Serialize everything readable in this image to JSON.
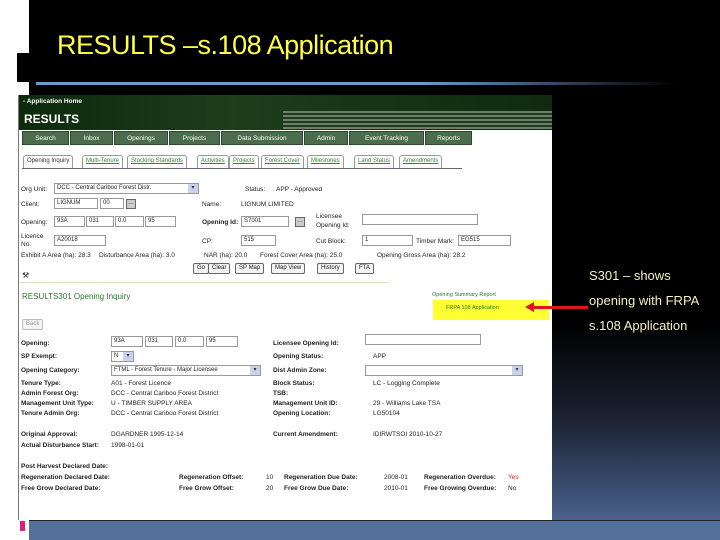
{
  "slide": {
    "title": "RESULTS –s.108 Application",
    "note_lines": [
      "S301 – shows",
      "opening with FRPA",
      "s.108 Application"
    ]
  },
  "app": {
    "home_link": "- Application Home",
    "brand": "RESULTS",
    "nav": [
      "Search",
      "Inbox",
      "Openings",
      "Projects",
      "Data Submission",
      "Admin",
      "Event Tracking",
      "Reports"
    ],
    "tabs": [
      "Opening Inquiry",
      "Multi-Tenure",
      "Stocking Standards",
      "Activities",
      "Projects",
      "Forest Cover",
      "Milestones",
      "Land Status",
      "Amendments"
    ]
  },
  "search": {
    "org_unit_label": "Org Unit:",
    "org_unit_value": "DCC - Central Cariboo Forest Distr.",
    "status_label": "Status:",
    "status_value": "APP - Approved",
    "client_label": "Client:",
    "client_value": "LIGNUM",
    "client_loc": "00",
    "name_label": "Name:",
    "name_value": "LIGNUM LIMITED",
    "opening_label": "Opening:",
    "opening_parts": [
      "93A",
      "031",
      "0.0",
      "95"
    ],
    "opening_id_label": "Opening Id:",
    "opening_id_value": "S7001",
    "licensee_label_1": "Licensee",
    "licensee_label_2": "Opening Id:",
    "licence_label_1": "Licence",
    "licence_label_2": "No:",
    "licence_value": "A20018",
    "cp_label": "CP:",
    "cp_value": "515",
    "cutblock_label": "Cut Block:",
    "cutblock_value": "1",
    "timber_label": "Timber Mark:",
    "timber_value": "EG515",
    "exhibit": "Exhibit A Area (ha): 28.3",
    "disturbance": "Disturbance Area (ha): 3.0",
    "nar": "NAR (ha): 20.0",
    "forest_cover": "Forest Cover Area (ha): 25.0",
    "gross": "Opening Gross Area (ha): 28.2",
    "buttons": [
      "Go",
      "Clear",
      "SP Map",
      "Map View",
      "History",
      "FTA"
    ]
  },
  "result": {
    "title": "RESULTS301   Opening Inquiry",
    "summary_link": "Opening Summary Report",
    "frpa_link": "FRPA 108 Application",
    "back": "Back",
    "opening_label": "Opening:",
    "opening_parts": [
      "93A",
      "031",
      "0.0",
      "95"
    ],
    "licensee_label": "Licensee Opening Id:",
    "sp_label": "SP Exempt:",
    "sp_value": "N",
    "status_label": "Opening Status:",
    "status_value": "APP",
    "category_label": "Opening Category:",
    "category_value": "FTML - Forest Tenure - Major Licensee",
    "zone_label": "Dist Admin Zone:",
    "tenure_type_label": "Tenure Type:",
    "tenure_type_value": "A01 - Forest Licence",
    "block_label": "Block Status:",
    "block_value": "LC - Logging Complete",
    "admin_org_label": "Admin Forest Org:",
    "admin_org_value": "DCC - Central Cariboo Forest District",
    "tsb_label": "TSB:",
    "mu_type_label": "Management Unit Type:",
    "mu_type_value": "U - TIMBER SUPPLY AREA",
    "mu_id_label": "Management Unit ID:",
    "mu_id_value": "29 - Williams Lake TSA",
    "tenure_admin_label": "Tenure Admin Org:",
    "tenure_admin_value": "DCC - Central Cariboo Forest District",
    "location_label": "Opening Location:",
    "location_value": "LG50104",
    "orig_label": "Original Approval:",
    "orig_value": "DGARDNER 1995-12-14",
    "amend_label": "Current Amendment:",
    "amend_value": "IDIRWTSOI 2010-10-27",
    "dist_label": "Actual Disturbance Start:",
    "dist_value": "1998-01-01",
    "post_harvest_label": "Post Harvest Declared Date:",
    "regen_declared_label": "Regeneration Declared Date:",
    "regen_offset_label": "Regeneration Offset:",
    "regen_offset_value": "10",
    "regen_due_label": "Regeneration Due Date:",
    "regen_due_value": "2008-01",
    "regen_overdue_label": "Regeneration Overdue:",
    "regen_overdue_value": "Yes",
    "fg_declared_label": "Free Grow Declared Date:",
    "fg_offset_label": "Free Grow Offset:",
    "fg_offset_value": "20",
    "fg_due_label": "Free Grow Due Date:",
    "fg_due_value": "2010-01",
    "fg_overdue_label": "Free Growing Overdue:",
    "fg_overdue_value": "No"
  }
}
